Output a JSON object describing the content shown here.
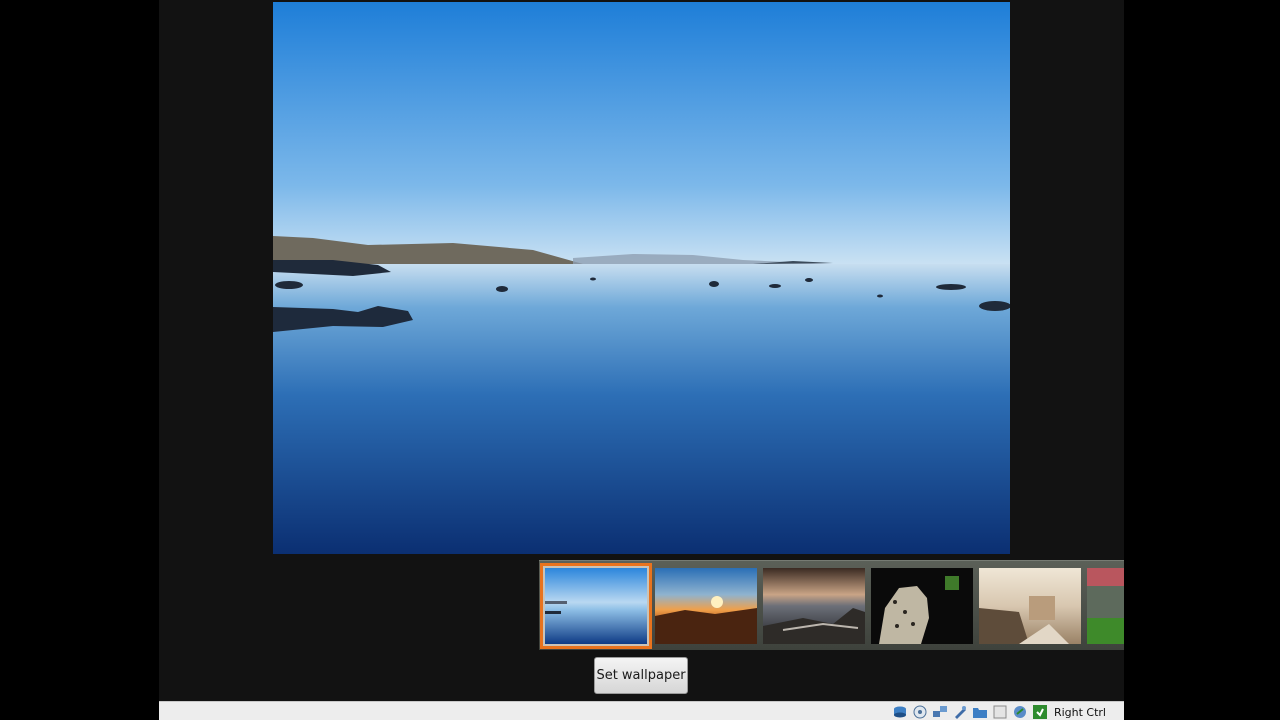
{
  "gallery": {
    "selected_index": 0,
    "thumbnails": [
      {
        "name": "lake-wallpaper"
      },
      {
        "name": "sunset-wallpaper"
      },
      {
        "name": "shore-wallpaper"
      },
      {
        "name": "leopard-wallpaper"
      },
      {
        "name": "path-wallpaper"
      },
      {
        "name": "partial-wallpaper"
      }
    ]
  },
  "actions": {
    "set_wallpaper_label": "Set wallpaper"
  },
  "statusbar": {
    "host_key_label": "Right Ctrl",
    "icons": [
      "hard-disk-icon",
      "optical-drive-icon",
      "network-icon",
      "usb-icon",
      "shared-folder-icon",
      "display-icon",
      "mouse-integration-icon",
      "host-key-icon"
    ]
  },
  "colors": {
    "selection_border": "#e8731e",
    "screen_background": "#121212"
  }
}
